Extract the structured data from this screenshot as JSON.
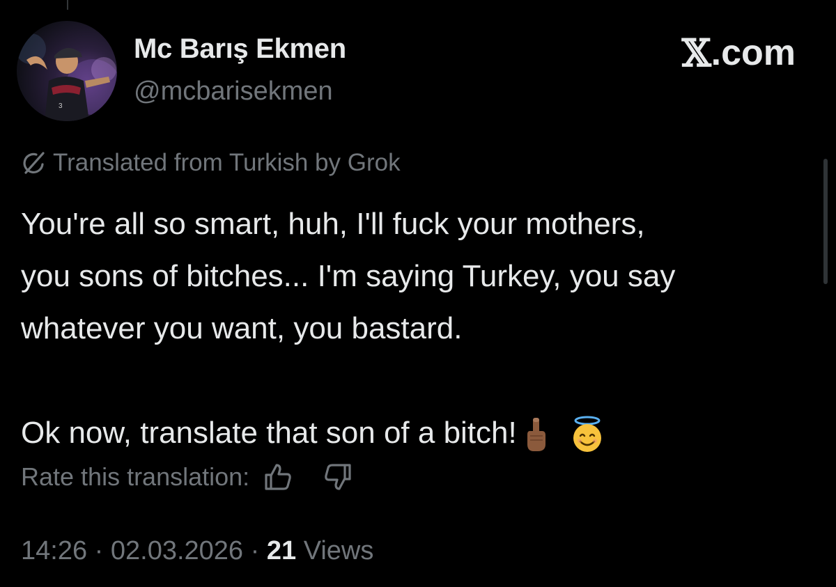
{
  "author": {
    "display_name": "Mc Barış Ekmen",
    "handle": "@mcbarisekmen"
  },
  "brand": {
    "x_glyph": "𝕏",
    "suffix": ".com"
  },
  "translation": {
    "label": "Translated from Turkish by Grok",
    "icon": "grok-icon"
  },
  "tweet": {
    "lines": [
      "You're all so smart, huh, I'll fuck your mothers,",
      "you sons of bitches... I'm saying Turkey, you say",
      "whatever you want, you bastard.",
      "Ok now, translate that son of a bitch!"
    ],
    "emojis": [
      "middle-finger-emoji",
      "smiling-face-with-halo-emoji"
    ]
  },
  "rating": {
    "label": "Rate this translation:",
    "icons": [
      "thumbs-up-icon",
      "thumbs-down-icon"
    ]
  },
  "meta": {
    "time": "14:26",
    "separator": "·",
    "date": "02.03.2026",
    "views_count": "21",
    "views_label": "Views"
  },
  "colors": {
    "background": "#000000",
    "primary_text": "#e7e9ea",
    "secondary_text": "#71767b"
  }
}
